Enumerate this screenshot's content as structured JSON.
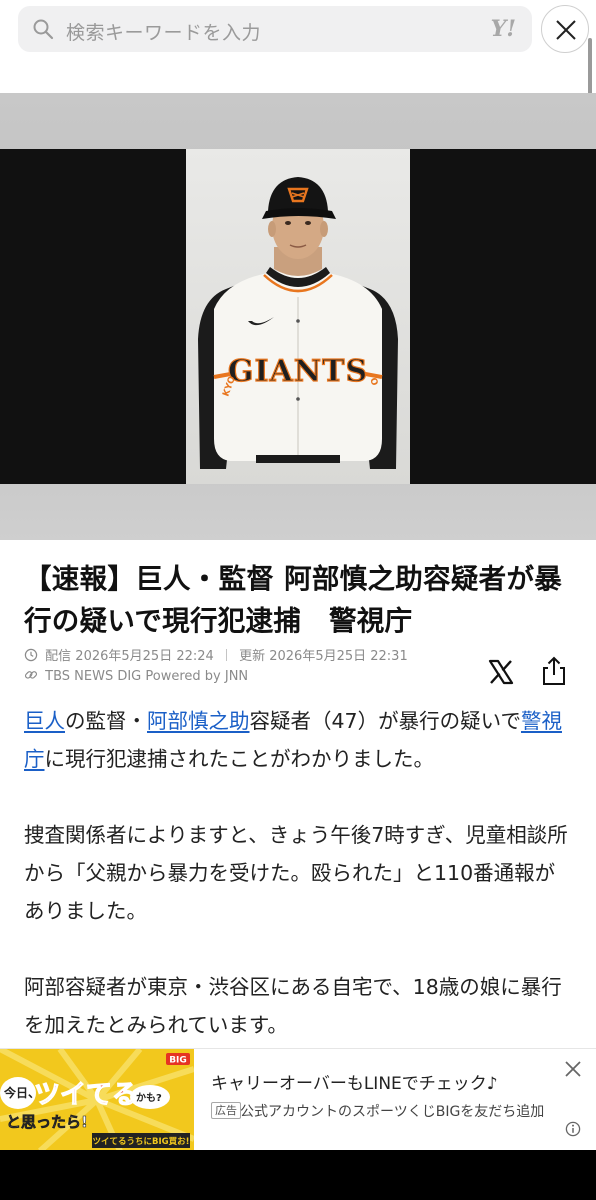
{
  "search": {
    "placeholder": "検索キーワードを入力",
    "logo": "Y!"
  },
  "article": {
    "headline": "【速報】巨人・監督 阿部慎之助容疑者が暴行の疑いで現行犯逮捕　警視庁",
    "meta": {
      "published_label": "配信",
      "published": "2026年5月25日 22:24",
      "updated_label": "更新",
      "updated": "2026年5月25日 22:31",
      "source": "TBS NEWS DIG Powered by JNN"
    },
    "paragraph1": {
      "link1": "巨人",
      "text1": "の監督・",
      "link2": "阿部慎之助",
      "text2": "容疑者（47）が暴行の疑いで",
      "link3": "警視庁",
      "text3": "に現行犯逮捕されたことがわかりました。"
    },
    "paragraph2": "捜査関係者によりますと、きょう午後7時すぎ、児童相談所から「父親から暴力を受けた。殴られた」と110番通報がありました。",
    "paragraph3": "阿部容疑者が東京・渋谷区にある自宅で、18歳の娘に暴行を加えたとみられています。"
  },
  "photo": {
    "jersey_text": "GIANTS",
    "sleeve_text": "KYO"
  },
  "ad": {
    "image": {
      "big_label": "BIG",
      "line1": "今日、",
      "line2": "ツイてる",
      "line3": "かも?",
      "line4": "と思ったら!",
      "tagline": "ツイてるうちにBIG買お!"
    },
    "title": "キャリーオーバーもLINEでチェック♪",
    "label": "広告",
    "desc": "公式アカウントのスポーツくじBIGを友だち追加"
  },
  "icons": [
    "search-icon",
    "close-icon",
    "clock-icon",
    "link-icon",
    "x-logo-icon",
    "share-icon",
    "ad-close-icon",
    "info-icon"
  ],
  "colors": {
    "link": "#1a5fc7",
    "ad_yellow": "#f2c81d",
    "ad_red": "#e63323",
    "giants_orange": "#e8761f"
  }
}
